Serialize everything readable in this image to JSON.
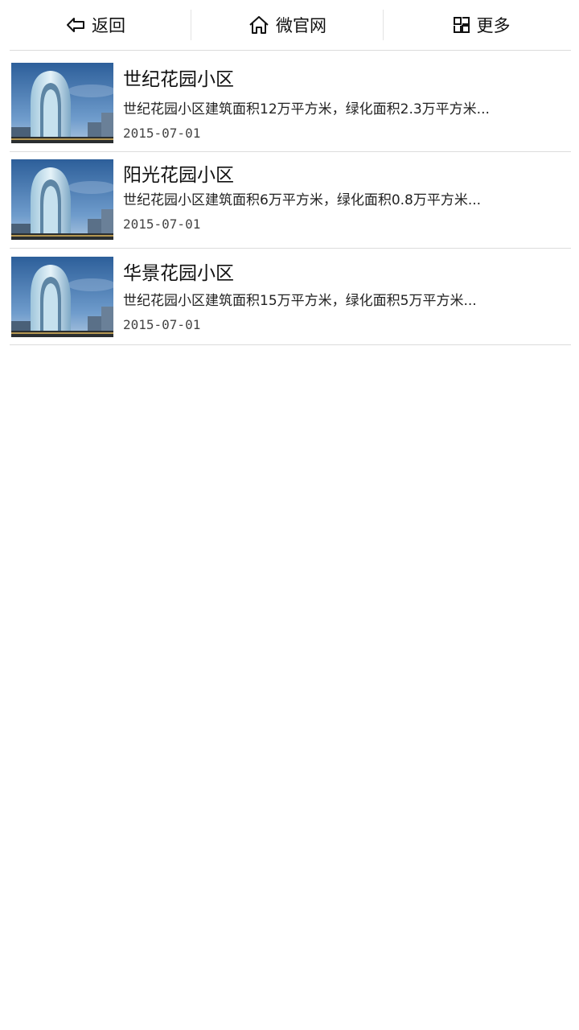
{
  "topbar": {
    "back_label": "返回",
    "home_label": "微官网",
    "more_label": "更多",
    "icons": [
      "back-arrow-icon",
      "home-icon",
      "grid-icon"
    ]
  },
  "items": [
    {
      "title": "世纪花园小区",
      "desc": "世纪花园小区建筑面积12万平方米，绿化面积2.3万平方米...",
      "date": "2015-07-01",
      "thumb": "building-image"
    },
    {
      "title": "阳光花园小区",
      "desc": "世纪花园小区建筑面积6万平方米，绿化面积0.8万平方米...",
      "date": "2015-07-01",
      "thumb": "building-image"
    },
    {
      "title": "华景花园小区",
      "desc": "世纪花园小区建筑面积15万平方米，绿化面积5万平方米...",
      "date": "2015-07-01",
      "thumb": "building-image"
    }
  ]
}
